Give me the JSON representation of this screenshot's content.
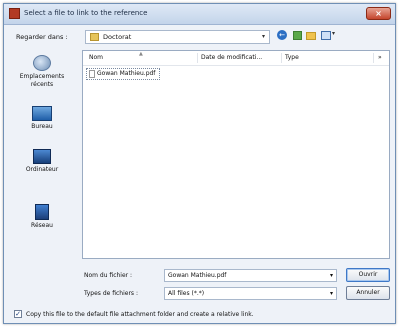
{
  "window": {
    "title": "Select a file to link to the reference",
    "close_label": "×"
  },
  "lookin": {
    "label": "Regarder dans :",
    "value": "Doctorat"
  },
  "toolbar": {
    "back_glyph": "←",
    "view_dropdown_glyph": "▾"
  },
  "places": [
    {
      "label": "Emplacements récents",
      "icon": "recent-places-icon"
    },
    {
      "label": "Bureau",
      "icon": "desktop-icon"
    },
    {
      "label": "Ordinateur",
      "icon": "computer-icon"
    },
    {
      "label": "Réseau",
      "icon": "network-icon"
    }
  ],
  "columns": [
    "Nom",
    "Date de modificati...",
    "Type"
  ],
  "files": [
    {
      "name": "Gowan Mathieu.pdf",
      "icon": "pdf-file-icon"
    }
  ],
  "filename": {
    "label": "Nom du fichier :",
    "value": "Gowan Mathieu.pdf"
  },
  "filetype": {
    "label": "Types de fichiers :",
    "value": "All files (*.*)"
  },
  "buttons": {
    "open": "Ouvrir",
    "cancel": "Annuler"
  },
  "option": {
    "checked": true,
    "check_glyph": "✓",
    "label": "Copy this file to the default file attachment folder and create a relative link."
  }
}
